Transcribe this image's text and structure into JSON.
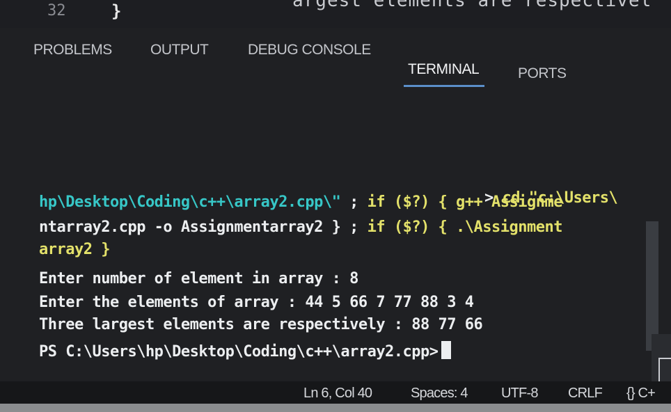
{
  "editor": {
    "line_number": "32",
    "brace": "}",
    "code_fragment": "argest elements are respectivel"
  },
  "panel": {
    "tabs": [
      {
        "label": "PROBLEMS",
        "active": false
      },
      {
        "label": "OUTPUT",
        "active": false
      },
      {
        "label": "DEBUG CONSOLE",
        "active": false
      },
      {
        "label": "TERMINAL",
        "active": true
      },
      {
        "label": "PORTS",
        "active": false
      }
    ]
  },
  "terminal": {
    "prompt_arrow": ">",
    "cmd_cd": "cd \"c:\\Users\\",
    "line1": "hp\\Desktop\\Coding\\c++\\array2.cpp\\\"",
    "line1_sep": " ; ",
    "line1_if": "if ($?) {",
    "line1_gpp": " g++ Assignme",
    "line2_a": "ntarray2.cpp -o Assignmentarray2 }",
    "line2_sep": " ; ",
    "line2_if": "if ($?) {",
    "line2_b": " .\\Assignment",
    "line3": "array2 }",
    "line4": "Enter number of element in array : 8",
    "line5": "Enter the elements of array : 44 5 66 7 77 88 3 4",
    "line6": "Three largest elements are respectively : 88 77 66",
    "prompt": "PS C:\\Users\\hp\\Desktop\\Coding\\c++\\array2.cpp>"
  },
  "status_bar": {
    "position": "Ln 6, Col 40",
    "spaces": "Spaces: 4",
    "encoding": "UTF-8",
    "eol": "CRLF",
    "language": "{} C+"
  },
  "colors": {
    "cyan": "#37c7c7",
    "yellow": "#e3e16a",
    "text": "#eceef0",
    "tab_underline": "#5b8fc9"
  }
}
